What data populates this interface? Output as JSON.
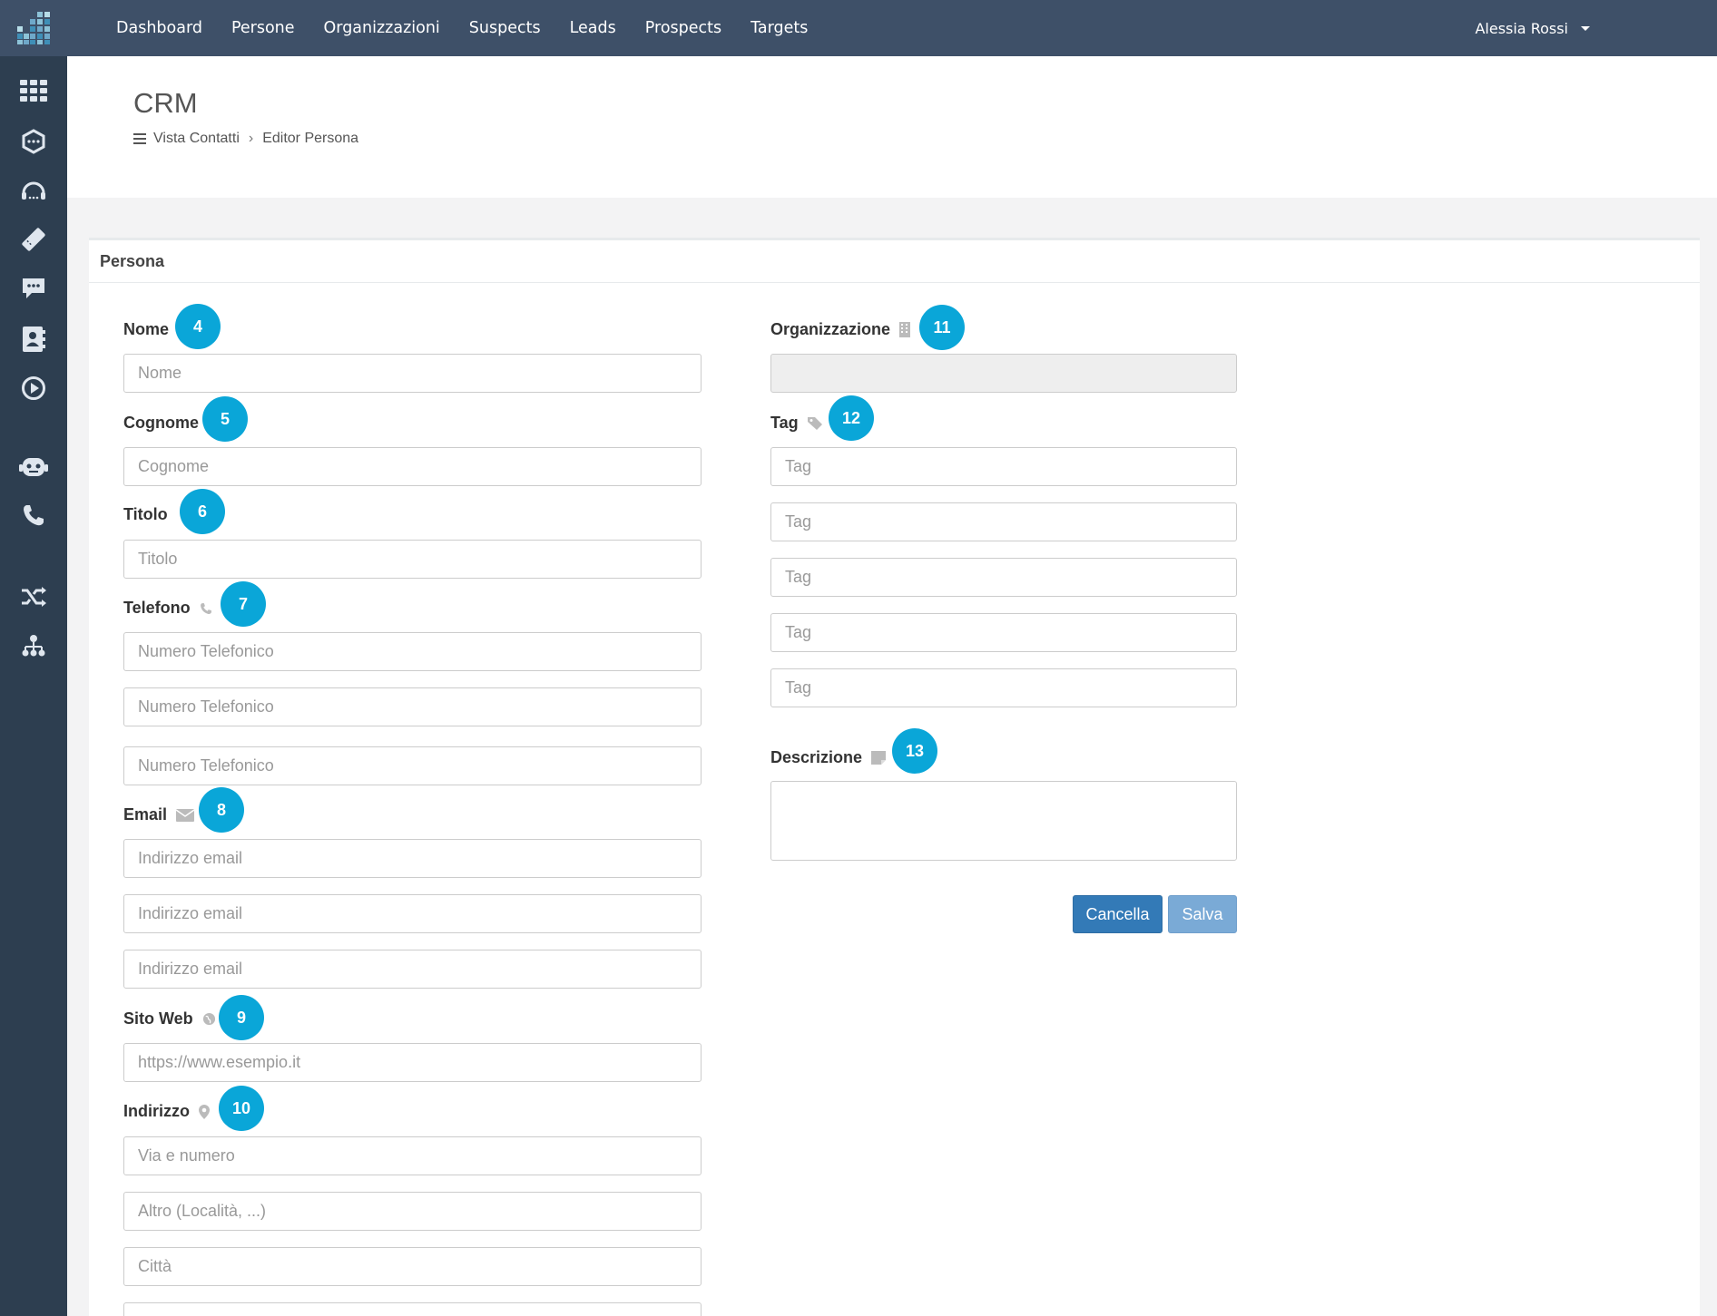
{
  "nav": {
    "items": [
      "Dashboard",
      "Persone",
      "Organizzazioni",
      "Suspects",
      "Leads",
      "Prospects",
      "Targets"
    ],
    "user": "Alessia Rossi"
  },
  "sidebar": {
    "icons": [
      "apps-grid-icon",
      "hexagon-icon",
      "headset-icon",
      "ticket-icon",
      "chat-icon",
      "contacts-book-icon",
      "play-icon",
      "robot-icon",
      "phone-icon",
      "shuffle-icon",
      "org-chart-icon"
    ]
  },
  "header": {
    "title": "CRM",
    "breadcrumb": [
      "Vista Contatti",
      "Editor Persona"
    ]
  },
  "panel": {
    "title": "Persona"
  },
  "form": {
    "nome": {
      "label": "Nome",
      "placeholder": "Nome",
      "badge": "4"
    },
    "cognome": {
      "label": "Cognome",
      "placeholder": "Cognome",
      "badge": "5"
    },
    "titolo": {
      "label": "Titolo",
      "placeholder": "Titolo",
      "badge": "6"
    },
    "telefono": {
      "label": "Telefono",
      "placeholder": "Numero Telefonico",
      "badge": "7"
    },
    "email": {
      "label": "Email",
      "placeholder": "Indirizzo email",
      "badge": "8"
    },
    "sito": {
      "label": "Sito Web",
      "placeholder": "https://www.esempio.it",
      "badge": "9"
    },
    "indirizzo": {
      "label": "Indirizzo",
      "badge": "10",
      "placeholders": [
        "Via e numero",
        "Altro (Località, ...)",
        "Città"
      ]
    },
    "organizzazione": {
      "label": "Organizzazione",
      "badge": "11"
    },
    "tag": {
      "label": "Tag",
      "placeholder": "Tag",
      "badge": "12"
    },
    "descrizione": {
      "label": "Descrizione",
      "badge": "13"
    }
  },
  "buttons": {
    "cancel": "Cancella",
    "save": "Salva"
  },
  "colors": {
    "topbar": "#3e5068",
    "sidebar": "#2d3e50",
    "badge": "#0aa6d8",
    "primary": "#337ab7"
  }
}
